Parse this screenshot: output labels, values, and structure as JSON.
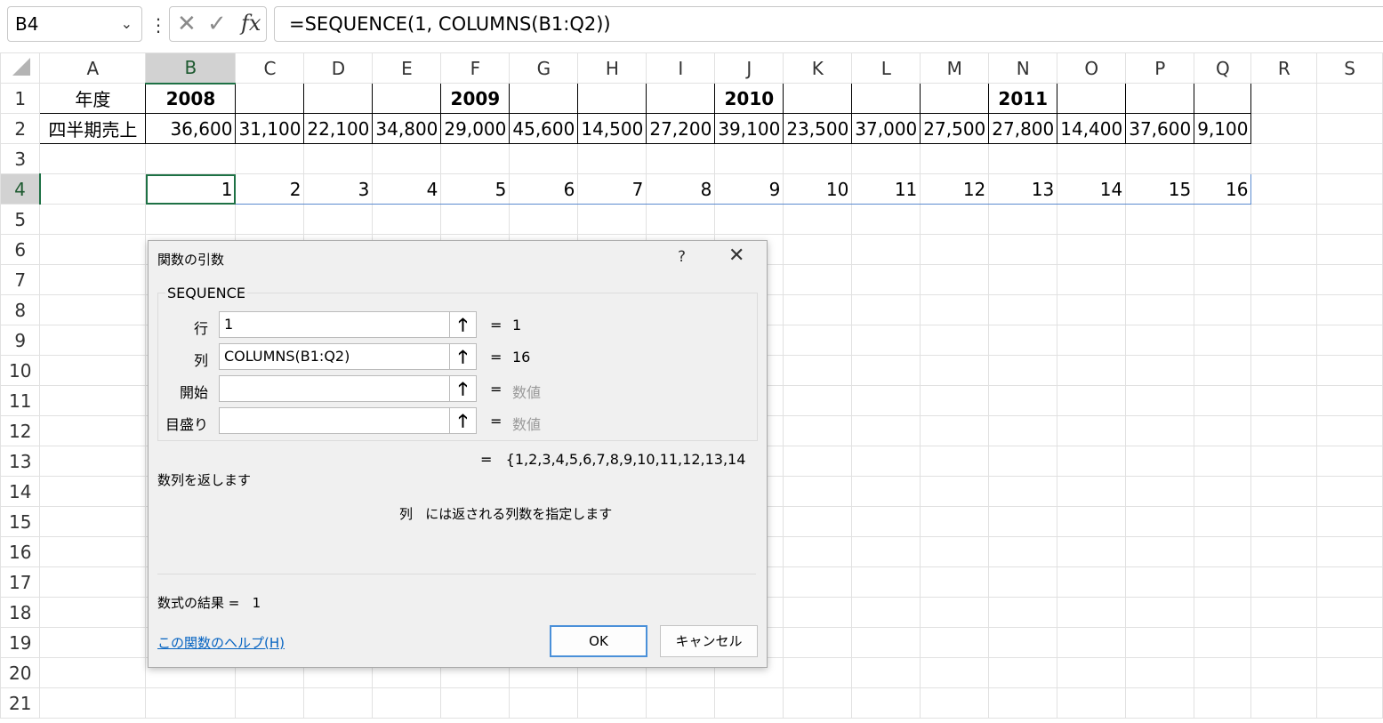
{
  "formula_bar": {
    "name_box": "B4",
    "formula": "=SEQUENCE(1, COLUMNS(B1:Q2))",
    "cancel_glyph": "✕",
    "enter_glyph": "✓",
    "fx_label": "fx"
  },
  "sheet": {
    "columns": [
      "A",
      "B",
      "C",
      "D",
      "E",
      "F",
      "G",
      "H",
      "I",
      "J",
      "K",
      "L",
      "M",
      "N",
      "O",
      "P",
      "Q",
      "R",
      "S"
    ],
    "rows": [
      "1",
      "2",
      "3",
      "4",
      "5",
      "6",
      "7",
      "8",
      "9",
      "10",
      "11",
      "12",
      "13",
      "14",
      "15",
      "16",
      "17",
      "18",
      "19",
      "20",
      "21"
    ],
    "row1": [
      "年度",
      "2008",
      "",
      "",
      "",
      "2009",
      "",
      "",
      "",
      "2010",
      "",
      "",
      "",
      "2011",
      "",
      "",
      ""
    ],
    "row2": [
      "四半期売上",
      "36,600",
      "31,100",
      "22,100",
      "34,800",
      "29,000",
      "45,600",
      "14,500",
      "27,200",
      "39,100",
      "23,500",
      "37,000",
      "27,500",
      "27,800",
      "14,400",
      "37,600",
      "9,100"
    ],
    "row4": [
      "",
      "1",
      "2",
      "3",
      "4",
      "5",
      "6",
      "7",
      "8",
      "9",
      "10",
      "11",
      "12",
      "13",
      "14",
      "15",
      "16"
    ]
  },
  "dialog": {
    "title": "関数の引数",
    "help_glyph": "?",
    "close_glyph": "✕",
    "function_name": "SEQUENCE",
    "args": [
      {
        "label": "行",
        "value": "1",
        "result": "1"
      },
      {
        "label": "列",
        "value": "COLUMNS(B1:Q2)",
        "result": "16"
      },
      {
        "label": "開始",
        "value": "",
        "result": "数値"
      },
      {
        "label": "目盛り",
        "value": "",
        "result": "数値"
      }
    ],
    "equals": "=",
    "result_array": "{1,2,3,4,5,6,7,8,9,10,11,12,13,14",
    "description": "数列を返します",
    "arg_description": "列   には返される列数を指定します",
    "formula_result_label": "数式の結果 =",
    "formula_result_value": "1",
    "help_link": "この関数のヘルプ(H)",
    "ok_label": "OK",
    "cancel_label": "キャンセル"
  }
}
